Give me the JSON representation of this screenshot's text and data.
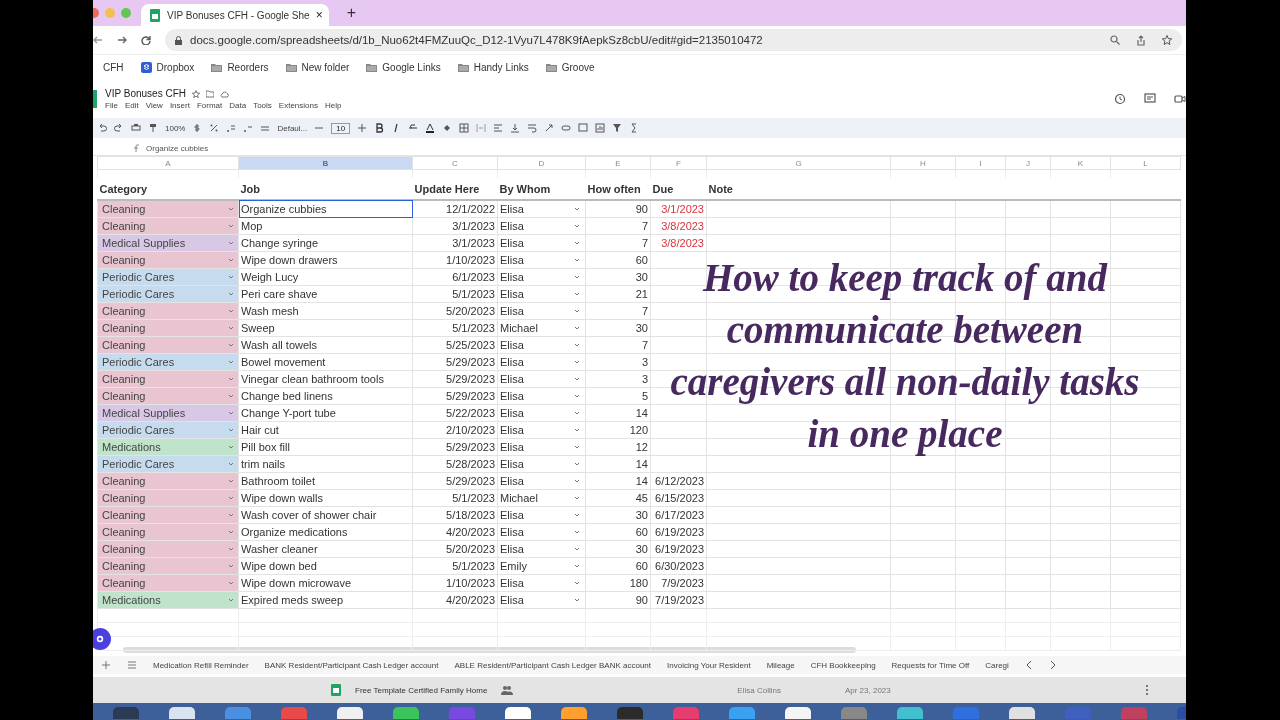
{
  "browser": {
    "tab_title": "VIP Bonuses CFH - Google She",
    "tab_close": "×",
    "new_tab": "+",
    "url": "docs.google.com/spreadsheets/d/1b_Nuo62t4FMZuuQc_D12-1Vyu7L478K9fAepkSz8cbU/edit#gid=2135010472",
    "bookmarks": [
      {
        "label": "CFH",
        "kind": "plain"
      },
      {
        "label": "Dropbox",
        "kind": "app"
      },
      {
        "label": "Reorders",
        "kind": "folder"
      },
      {
        "label": "New folder",
        "kind": "folder"
      },
      {
        "label": "Google Links",
        "kind": "folder"
      },
      {
        "label": "Handy Links",
        "kind": "folder"
      },
      {
        "label": "Groove",
        "kind": "folder"
      }
    ]
  },
  "document": {
    "title": "VIP Bonuses CFH",
    "menu": [
      "File",
      "Edit",
      "View",
      "Insert",
      "Format",
      "Data",
      "Tools",
      "Extensions",
      "Help"
    ]
  },
  "toolbar": {
    "zoom": "100%",
    "font": "Defaul...",
    "font_size": "10"
  },
  "formula_bar": {
    "value": "Organize cubbies"
  },
  "columns": [
    {
      "label": "A",
      "selected": false
    },
    {
      "label": "B",
      "selected": true
    },
    {
      "label": "C",
      "selected": false
    },
    {
      "label": "D",
      "selected": false
    },
    {
      "label": "E",
      "selected": false
    },
    {
      "label": "F",
      "selected": false
    },
    {
      "label": "G",
      "selected": false
    },
    {
      "label": "H",
      "selected": false
    },
    {
      "label": "I",
      "selected": false
    },
    {
      "label": "J",
      "selected": false
    },
    {
      "label": "K",
      "selected": false
    },
    {
      "label": "L",
      "selected": false
    }
  ],
  "headers": [
    "Category",
    "Job",
    "Update Here",
    "By Whom",
    "How often",
    "Due",
    "Note"
  ],
  "rows": [
    {
      "category": "Cleaning",
      "color": "#e8c5d0",
      "job": "Organize cubbies",
      "updated": "12/1/2022",
      "by": "Elisa",
      "often": "90",
      "due": "3/1/2023",
      "overdue": true,
      "selected": true
    },
    {
      "category": "Cleaning",
      "color": "#e8c5d0",
      "job": "Mop",
      "updated": "3/1/2023",
      "by": "Elisa",
      "often": "7",
      "due": "3/8/2023",
      "overdue": true,
      "selected": false
    },
    {
      "category": "Medical Supplies",
      "color": "#d8c8e6",
      "job": "Change syringe",
      "updated": "3/1/2023",
      "by": "Elisa",
      "often": "7",
      "due": "3/8/2023",
      "overdue": true,
      "selected": false
    },
    {
      "category": "Cleaning",
      "color": "#e8c5d0",
      "job": "Wipe down drawers",
      "updated": "1/10/2023",
      "by": "Elisa",
      "often": "60",
      "selected": false
    },
    {
      "category": "Periodic Cares",
      "color": "#c6dcee",
      "job": "Weigh Lucy",
      "updated": "6/1/2023",
      "by": "Elisa",
      "often": "30",
      "selected": false
    },
    {
      "category": "Periodic Cares",
      "color": "#c6dcee",
      "job": "Peri care shave",
      "updated": "5/1/2023",
      "by": "Elisa",
      "often": "21",
      "selected": false
    },
    {
      "category": "Cleaning",
      "color": "#e8c5d0",
      "job": "Wash mesh",
      "updated": "5/20/2023",
      "by": "Elisa",
      "often": "7",
      "selected": false
    },
    {
      "category": "Cleaning",
      "color": "#e8c5d0",
      "job": "Sweep",
      "updated": "5/1/2023",
      "by": "Michael",
      "often": "30",
      "selected": false
    },
    {
      "category": "Cleaning",
      "color": "#e8c5d0",
      "job": "Wash all towels",
      "updated": "5/25/2023",
      "by": "Elisa",
      "often": "7",
      "selected": false
    },
    {
      "category": "Periodic Cares",
      "color": "#c6dcee",
      "job": "Bowel movement",
      "updated": "5/29/2023",
      "by": "Elisa",
      "often": "3",
      "selected": false
    },
    {
      "category": "Cleaning",
      "color": "#e8c5d0",
      "job": "Vinegar clean bathroom tools",
      "updated": "5/29/2023",
      "by": "Elisa",
      "often": "3",
      "selected": false
    },
    {
      "category": "Cleaning",
      "color": "#e8c5d0",
      "job": "Change bed linens",
      "updated": "5/29/2023",
      "by": "Elisa",
      "often": "5",
      "selected": false
    },
    {
      "category": "Medical Supplies",
      "color": "#d8c8e6",
      "job": "Change Y-port tube",
      "updated": "5/22/2023",
      "by": "Elisa",
      "often": "14",
      "selected": false
    },
    {
      "category": "Periodic Cares",
      "color": "#c6dcee",
      "job": "Hair cut",
      "updated": "2/10/2023",
      "by": "Elisa",
      "often": "120",
      "selected": false
    },
    {
      "category": "Medications",
      "color": "#bfe3cb",
      "job": "Pill box fill",
      "updated": "5/29/2023",
      "by": "Elisa",
      "often": "12",
      "selected": false
    },
    {
      "category": "Periodic Cares",
      "color": "#c6dcee",
      "job": "trim nails",
      "updated": "5/28/2023",
      "by": "Elisa",
      "often": "14",
      "selected": false
    },
    {
      "category": "Cleaning",
      "color": "#e8c5d0",
      "job": "Bathroom toilet",
      "updated": "5/29/2023",
      "by": "Elisa",
      "often": "14",
      "due": "6/12/2023",
      "overdue": false,
      "selected": false
    },
    {
      "category": "Cleaning",
      "color": "#e8c5d0",
      "job": "Wipe down walls",
      "updated": "5/1/2023",
      "by": "Michael",
      "often": "45",
      "due": "6/15/2023",
      "overdue": false,
      "selected": false
    },
    {
      "category": "Cleaning",
      "color": "#e8c5d0",
      "job": "Wash cover of shower chair",
      "updated": "5/18/2023",
      "by": "Elisa",
      "often": "30",
      "due": "6/17/2023",
      "overdue": false,
      "selected": false
    },
    {
      "category": "Cleaning",
      "color": "#e8c5d0",
      "job": "Organize medications",
      "updated": "4/20/2023",
      "by": "Elisa",
      "often": "60",
      "due": "6/19/2023",
      "overdue": false,
      "selected": false
    },
    {
      "category": "Cleaning",
      "color": "#e8c5d0",
      "job": "Washer cleaner",
      "updated": "5/20/2023",
      "by": "Elisa",
      "often": "30",
      "due": "6/19/2023",
      "overdue": false,
      "selected": false
    },
    {
      "category": "Cleaning",
      "color": "#e8c5d0",
      "job": "Wipe down bed",
      "updated": "5/1/2023",
      "by": "Emily",
      "often": "60",
      "due": "6/30/2023",
      "overdue": false,
      "selected": false
    },
    {
      "category": "Cleaning",
      "color": "#e8c5d0",
      "job": "Wipe down microwave",
      "updated": "1/10/2023",
      "by": "Elisa",
      "often": "180",
      "due": "7/9/2023",
      "overdue": false,
      "selected": false
    },
    {
      "category": "Medications",
      "color": "#bfe3cb",
      "job": "Expired meds sweep",
      "updated": "4/20/2023",
      "by": "Elisa",
      "often": "90",
      "due": "7/19/2023",
      "overdue": false,
      "selected": false
    }
  ],
  "overlay_caption": "How to keep track of and communicate between caregivers all non-daily tasks in one place",
  "sheet_tabs": [
    {
      "label": "Medication Refill Reminder",
      "selected": false
    },
    {
      "label": "BANK Resident/Participant Cash Ledger account",
      "selected": false
    },
    {
      "label": "ABLE Resident/Participant Cash Ledger BANK account",
      "selected": false
    },
    {
      "label": "Invoicing Your Resident",
      "selected": false
    },
    {
      "label": "Mileage",
      "selected": false
    },
    {
      "label": "CFH Bookkeeping",
      "selected": false
    },
    {
      "label": "Requests for Time Off",
      "selected": false
    },
    {
      "label": "Caregi",
      "selected": false
    }
  ],
  "file_row": {
    "name": "Free Template Certified Family Home",
    "owner": "Elisa Collins",
    "date": "Apr 23, 2023"
  }
}
